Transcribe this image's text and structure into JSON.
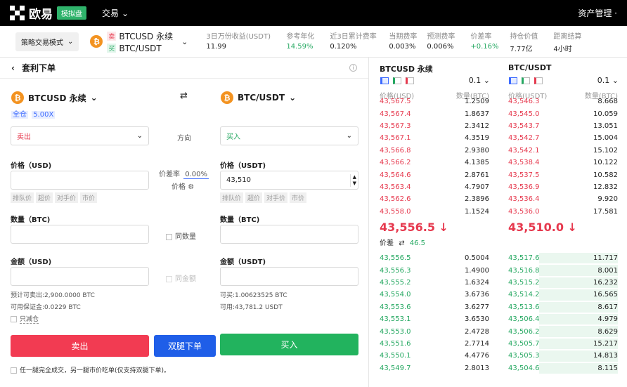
{
  "topbar": {
    "logo_text": "欧易",
    "demo_badge": "模拟盘",
    "nav_trade": "交易",
    "asset_mgmt": "资产管理 ·"
  },
  "infobar": {
    "mode_button": "策略交易模式",
    "sell_tag": "卖",
    "sell_pair": "BTCUSD 永续",
    "buy_tag": "买",
    "buy_pair": "BTC/USDT",
    "stats": [
      {
        "label": "3日万份收益(USDT)",
        "value": "11.99"
      },
      {
        "label": "参考年化",
        "value": "14.59%"
      },
      {
        "label": "近3日累计费率",
        "value": "0.120%"
      },
      {
        "label": "当期费率",
        "value": "0.003%"
      },
      {
        "label": "预测费率",
        "value": "0.006%"
      },
      {
        "label": "价差率",
        "value": "+0.16%"
      },
      {
        "label": "持仓价值",
        "value": "7.77亿"
      },
      {
        "label": "距离结算",
        "value": "4小时"
      }
    ]
  },
  "order": {
    "title": "套利下单",
    "left_asset": "BTCUSD 永续",
    "margin_mode": "全仓",
    "leverage": "5.00X",
    "right_asset": "BTC/USDT",
    "left_side": "卖出",
    "direction_label": "方向",
    "right_side": "买入",
    "left_price_label": "价格（USD)",
    "right_price_label": "价格（USDT)",
    "right_price_value": "43,510",
    "spread_rate_label": "价差率",
    "spread_rate_value": "0.00%",
    "price_label": "价格",
    "price_chips": [
      "排队价",
      "超价",
      "对手价",
      "市价"
    ],
    "qty_label": "数量（BTC)",
    "same_qty": "同数量",
    "amount_left_label": "金额（USD)",
    "amount_right_label": "金额（USDT)",
    "same_amount": "同金额",
    "est_sell": "预计可卖出:2,900.0000 BTC",
    "avail_margin": "可用保证金:0.0229 BTC",
    "reduce_only": "只减仓",
    "can_buy": "可买:1.00623525 BTC",
    "avail_usdt": "可用:43,781.2 USDT",
    "btn_sell": "卖出",
    "btn_dual": "双腿下单",
    "btn_buy": "买入",
    "footer_note": "任一腿完全成交，另一腿市价吃单(仅支持双腿下单)。"
  },
  "book": {
    "colors": {
      "ask": "#e6394e",
      "bid": "#25a861",
      "depth": "#eaf7ef"
    },
    "spread_label": "价差",
    "spread_value": "46.5",
    "left": {
      "title": "BTCUSD 永续",
      "step": "0.1",
      "price_header": "价格(USD)",
      "qty_header": "数量(BTC)",
      "mid": "43,556.5",
      "asks": [
        [
          "43,567.5",
          "1.2509"
        ],
        [
          "43,567.4",
          "1.8637"
        ],
        [
          "43,567.3",
          "2.3412"
        ],
        [
          "43,567.1",
          "4.3519"
        ],
        [
          "43,566.8",
          "2.9380"
        ],
        [
          "43,566.2",
          "4.1385"
        ],
        [
          "43,564.6",
          "2.8761"
        ],
        [
          "43,563.4",
          "4.7907"
        ],
        [
          "43,562.6",
          "2.3896"
        ],
        [
          "43,558.0",
          "1.1524"
        ]
      ],
      "bids": [
        [
          "43,556.5",
          "0.5004",
          0
        ],
        [
          "43,556.3",
          "1.4900",
          0
        ],
        [
          "43,555.2",
          "1.6324",
          0
        ],
        [
          "43,554.0",
          "3.6736",
          0
        ],
        [
          "43,553.6",
          "3.6277",
          0
        ],
        [
          "43,553.1",
          "3.6530",
          0
        ],
        [
          "43,553.0",
          "2.4728",
          0
        ],
        [
          "43,551.6",
          "2.7714",
          0
        ],
        [
          "43,550.1",
          "4.4776",
          0
        ],
        [
          "43,549.7",
          "2.8013",
          0
        ]
      ]
    },
    "right": {
      "title": "BTC/USDT",
      "step": "0.1",
      "price_header": "价格(USDT)",
      "qty_header": "数量(BTC)",
      "mid": "43,510.0",
      "asks": [
        [
          "43,546.3",
          "8.668"
        ],
        [
          "43,545.0",
          "10.059"
        ],
        [
          "43,543.7",
          "13.051"
        ],
        [
          "43,542.7",
          "15.004"
        ],
        [
          "43,542.1",
          "15.102"
        ],
        [
          "43,538.4",
          "10.122"
        ],
        [
          "43,537.5",
          "10.582"
        ],
        [
          "43,536.9",
          "12.832"
        ],
        [
          "43,536.4",
          "9.920"
        ],
        [
          "43,536.0",
          "17.581"
        ]
      ],
      "bids": [
        [
          "43,517.6",
          "11.717",
          0.72
        ],
        [
          "43,516.8",
          "8.001",
          0.72
        ],
        [
          "43,515.2",
          "16.232",
          0.72
        ],
        [
          "43,514.2",
          "16.565",
          0.72
        ],
        [
          "43,513.6",
          "8.617",
          0.72
        ],
        [
          "43,506.4",
          "4.979",
          0.72
        ],
        [
          "43,506.2",
          "8.629",
          0.72
        ],
        [
          "43,505.7",
          "15.217",
          0.72
        ],
        [
          "43,505.3",
          "14.813",
          0.72
        ],
        [
          "43,504.6",
          "8.115",
          0.72
        ]
      ]
    }
  }
}
